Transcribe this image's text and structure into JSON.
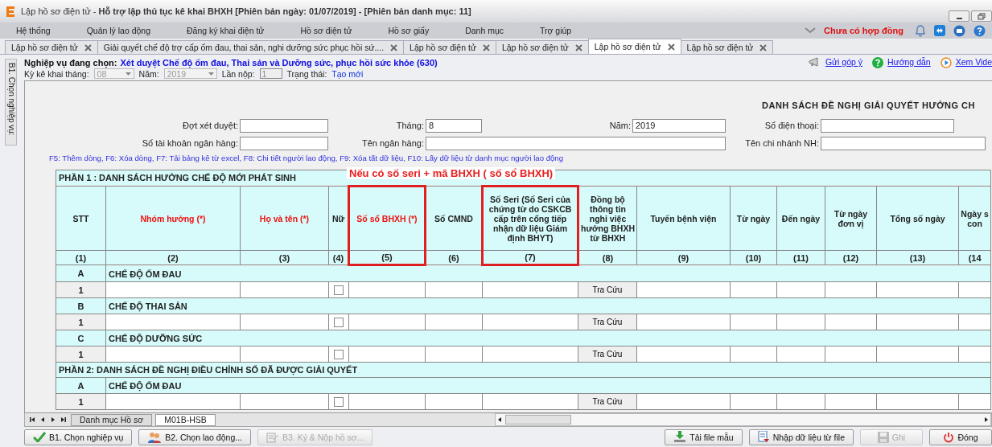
{
  "window": {
    "title": "Lập hồ sơ điện tử - **Hỗ trợ lập thủ tục kê khai BHXH [Phiên bản ngày: 01/07/2019] - [Phiên bản danh mục: 11]**"
  },
  "menu": [
    "Hệ thống",
    "Quản lý lao động",
    "Đăng ký khai điện tử",
    "Hồ sơ điện tử",
    "Hồ sơ giấy",
    "Danh mục",
    "Trợ giúp"
  ],
  "contract_status": "Chưa có hợp đồng",
  "tabs": [
    {
      "label": "Lập hồ sơ điện tử",
      "selected": false
    },
    {
      "label": "Giải quyết chế độ trợ cấp ốm đau, thai sản, nghi dưỡng sức phục hồi sứ....",
      "selected": false
    },
    {
      "label": "Lập hồ sơ điện tử",
      "selected": false
    },
    {
      "label": "Lập hồ sơ điện tử",
      "selected": false
    },
    {
      "label": "Lập hồ sơ điện tử",
      "selected": true
    },
    {
      "label": "Lập hồ sơ điện tử",
      "selected": false
    }
  ],
  "side_tab": "B1. Chọn nghiệp vụ:",
  "operation": {
    "label": "Nghiệp vụ đang chọn:",
    "value": "Xét duyệt Chế độ ốm đau, Thai sản và Dưỡng sức, phục hồi sức khỏe (630)"
  },
  "period": {
    "month_label": "Kỳ kê khai tháng:",
    "month": "08",
    "year_label": "Năm:",
    "year": "2019",
    "submission_label": "Lần nộp:",
    "submission": "1",
    "status_label": "Trạng thái:",
    "status": "Tạo mới"
  },
  "links": [
    {
      "kind": "feedback",
      "label": "Gửi góp ý"
    },
    {
      "kind": "help",
      "label": "Hướng dẫn"
    },
    {
      "kind": "video",
      "label": "Xem Vide"
    }
  ],
  "form": {
    "title": "DANH SÁCH ĐỀ NGHỊ GIẢI QUYẾT HƯỞNG CH",
    "fields": [
      {
        "label": "Đợt xét duyệt:"
      },
      {
        "label": "Tháng:",
        "value": "8"
      },
      {
        "label": "Năm:",
        "value": "2019"
      },
      {
        "label": "Số điện thoại:"
      },
      {
        "label": "Số tài khoản ngân hàng:"
      },
      {
        "label": "Tên ngân hàng:"
      },
      {
        "label": "Tên chi nhánh NH:"
      }
    ]
  },
  "hint": "F5: Thêm dòng, F6: Xóa dòng, F7: Tải bảng kê từ excel, F8: Chi tiết người lao động, F9: Xóa tất dữ liệu, F10: Lấy dữ liệu từ danh mục người lao động",
  "table": {
    "columns": [
      {
        "label": "STT",
        "number": "(1)",
        "kind": "stt",
        "required": false,
        "highlighted": false
      },
      {
        "label": "Nhóm hưởng (*)",
        "number": "(2)",
        "kind": "text",
        "required": true,
        "highlighted": false
      },
      {
        "label": "Họ và tên (*)",
        "number": "(3)",
        "kind": "text",
        "required": true,
        "highlighted": false
      },
      {
        "label": "Nữ",
        "number": "(4)",
        "kind": "check",
        "required": false,
        "highlighted": false
      },
      {
        "label": "Số sổ BHXH (*)",
        "number": "(5)",
        "kind": "text",
        "required": true,
        "highlighted": true
      },
      {
        "label": "Số CMND",
        "number": "(6)",
        "kind": "text",
        "required": false,
        "highlighted": false
      },
      {
        "label": "Số Seri (Số Seri của chứng từ do CSKCB cấp trên cổng tiếp nhận dữ liệu Giám định BHYT)",
        "number": "(7)",
        "kind": "text",
        "required": false,
        "highlighted": true
      },
      {
        "label": "Đồng bộ thông tin nghi việc hưởng BHXH từ BHXH",
        "number": "(8)",
        "kind": "lookup",
        "required": false,
        "highlighted": false
      },
      {
        "label": "Tuyến bệnh viện",
        "number": "(9)",
        "kind": "text",
        "required": false,
        "highlighted": false
      },
      {
        "label": "Từ ngày",
        "number": "(10)",
        "kind": "text",
        "required": false,
        "highlighted": false
      },
      {
        "label": "Đến ngày",
        "number": "(11)",
        "kind": "text",
        "required": false,
        "highlighted": false
      },
      {
        "label": "Từ ngày đơn vị",
        "number": "(12)",
        "kind": "text",
        "required": false,
        "highlighted": false
      },
      {
        "label": "Tổng số ngày",
        "number": "(13)",
        "kind": "text",
        "required": false,
        "highlighted": false
      },
      {
        "label": "Ngày s\ncon",
        "number": "(14",
        "kind": "text",
        "required": false,
        "highlighted": false
      }
    ],
    "rows": [
      {
        "kind": "section",
        "label": "PHẦN 1 : DANH SÁCH HƯỞNG CHẾ ĐỘ MỚI PHÁT SINH",
        "note": "Nếu có số seri + mã BHXH ( số sổ BHXH)"
      },
      {
        "kind": "group",
        "code": "A",
        "label": "CHẾ ĐỘ ỐM ĐAU"
      },
      {
        "kind": "entry",
        "stt": "1",
        "female": false,
        "lookup": "Tra Cứu"
      },
      {
        "kind": "group",
        "code": "B",
        "label": "CHẾ ĐỘ THAI SẢN"
      },
      {
        "kind": "entry",
        "stt": "1",
        "female": false,
        "lookup": "Tra Cứu"
      },
      {
        "kind": "group",
        "code": "C",
        "label": "CHẾ ĐỘ DƯỠNG SỨC"
      },
      {
        "kind": "entry",
        "stt": "1",
        "female": false,
        "lookup": "Tra Cứu"
      },
      {
        "kind": "section",
        "label": "PHẦN 2: DANH SÁCH ĐỀ NGHỊ ĐIỀU CHỈNH SỐ ĐÃ ĐƯỢC GIẢI QUYẾT"
      },
      {
        "kind": "group",
        "code": "A",
        "label": "CHẾ ĐỘ ỐM ĐAU"
      },
      {
        "kind": "entry",
        "stt": "1",
        "female": false,
        "lookup": "Tra Cứu"
      }
    ]
  },
  "sheet_tabs": [
    {
      "label": "Danh mục Hồ sơ",
      "selected": false
    },
    {
      "label": "M01B-HSB",
      "selected": true
    }
  ],
  "buttons_left": [
    {
      "kind": "check",
      "label": "B1. Chọn nghiệp vụ",
      "disabled": false
    },
    {
      "kind": "people",
      "label": "B2. Chọn lao động...",
      "disabled": false
    },
    {
      "kind": "sign",
      "label": "B3. Ký & Nộp hồ sơ...",
      "disabled": true
    }
  ],
  "buttons_right": [
    {
      "kind": "download",
      "label": "Tải file mẫu",
      "disabled": false
    },
    {
      "kind": "import",
      "label": "Nhập dữ liệu từ file",
      "disabled": false
    },
    {
      "kind": "save",
      "label": "Ghi",
      "disabled": true
    },
    {
      "kind": "power",
      "label": "Đóng",
      "disabled": false
    }
  ]
}
